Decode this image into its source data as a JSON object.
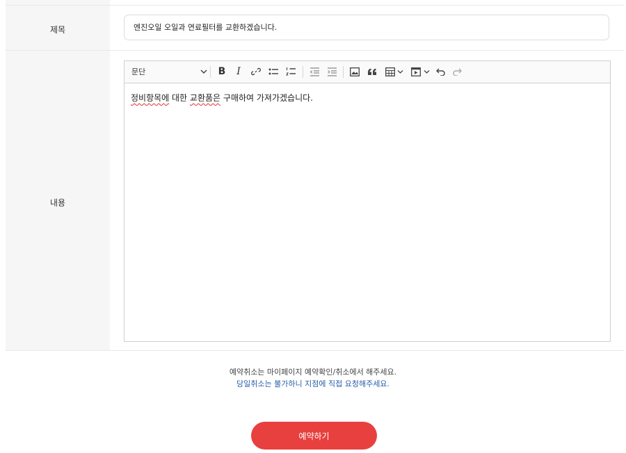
{
  "form": {
    "title_label": "제목",
    "title_value": "엔진오일 오일과 연료필터를 교환하겠습니다.",
    "content_label": "내용"
  },
  "editor": {
    "paragraph_select": "문단",
    "bold_label": "B",
    "italic_label": "I",
    "content_words": {
      "w1": "정비항목에",
      "w2": " 대한 ",
      "w3": "교환품은",
      "w4": " 구매하여 가져가겠습니다."
    }
  },
  "notice": {
    "line1": "예약취소는 마이페이지 예약확인/취소에서 해주세요.",
    "line2": "당일취소는 불가하니 지점에 직접 요청해주세요.",
    "line2_color": "#2a5da8"
  },
  "submit_label": "예약하기",
  "colors": {
    "accent": "#e83f3f",
    "label_bg": "#f6f6f6"
  }
}
